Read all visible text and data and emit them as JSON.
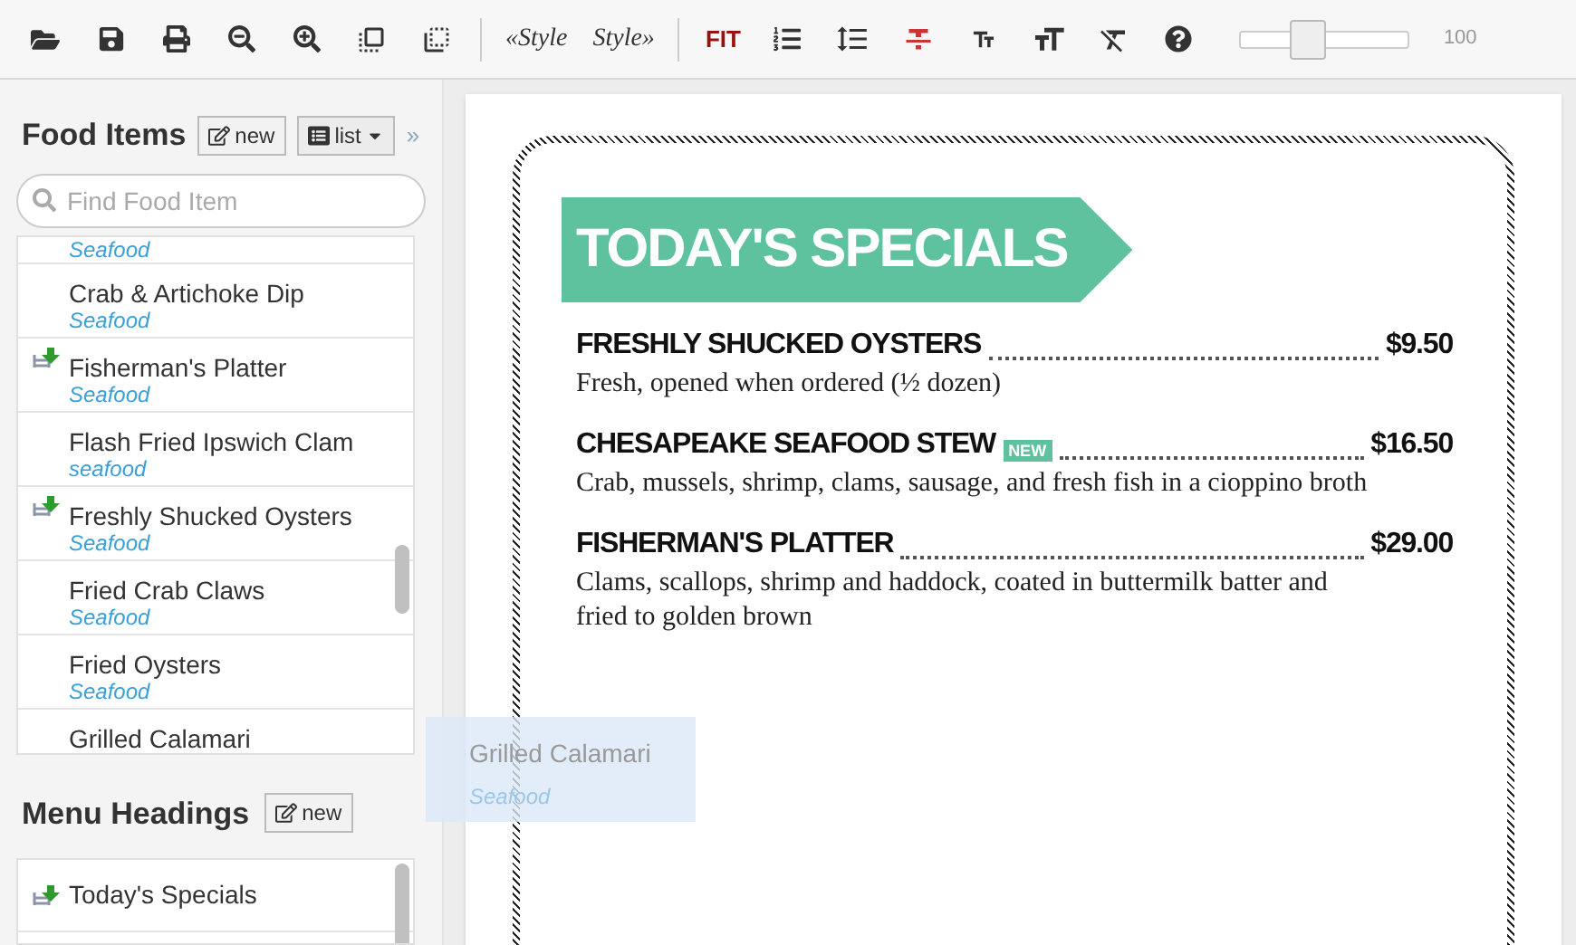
{
  "toolbar": {
    "style_buttons": [
      "«Style",
      "Style»"
    ],
    "fit": "FIT",
    "zoom": {
      "level": 0.4,
      "reading": "100"
    }
  },
  "food_items": {
    "title": "Food Items",
    "new_button": "new",
    "view_button": "list",
    "collapse": "»",
    "search": {
      "placeholder": "Find Food Item"
    },
    "items": [
      {
        "category": "Seafood",
        "placed": false
      },
      {
        "name": "Crab & Artichoke Dip",
        "category": "Seafood",
        "placed": false
      },
      {
        "name": "Fisherman's Platter",
        "category": "Seafood",
        "placed": true
      },
      {
        "name": "Flash Fried Ipswich Clam",
        "category": "seafood",
        "placed": false
      },
      {
        "name": "Freshly Shucked Oysters",
        "category": "Seafood",
        "placed": true
      },
      {
        "name": "Fried Crab Claws",
        "category": "Seafood",
        "placed": false
      },
      {
        "name": "Fried Oysters",
        "category": "Seafood",
        "placed": false
      },
      {
        "name": "Grilled Calamari",
        "placed": false
      }
    ]
  },
  "menu_headings": {
    "title": "Menu Headings",
    "new_button": "new",
    "items": [
      {
        "name": "Today's Specials",
        "placed": true
      }
    ]
  },
  "drag_preview": {
    "name": "Grilled Calamari",
    "category": "Seafood"
  },
  "menu": {
    "heading": "TODAY'S SPECIALS",
    "items": [
      {
        "name": "FRESHLY SHUCKED OYSTERS",
        "price": "$9.50",
        "description": "Fresh, opened when ordered (½ dozen)"
      },
      {
        "name": "CHESAPEAKE SEAFOOD STEW",
        "badge": "NEW",
        "price": "$16.50",
        "description": "Crab, mussels, shrimp, clams, sausage, and fresh fish in a cioppino broth"
      },
      {
        "name": "FISHERMAN'S PLATTER",
        "price": "$29.00",
        "description": "Clams, scallops, shrimp and haddock, coated in buttermilk batter and fried to golden brown"
      }
    ]
  }
}
